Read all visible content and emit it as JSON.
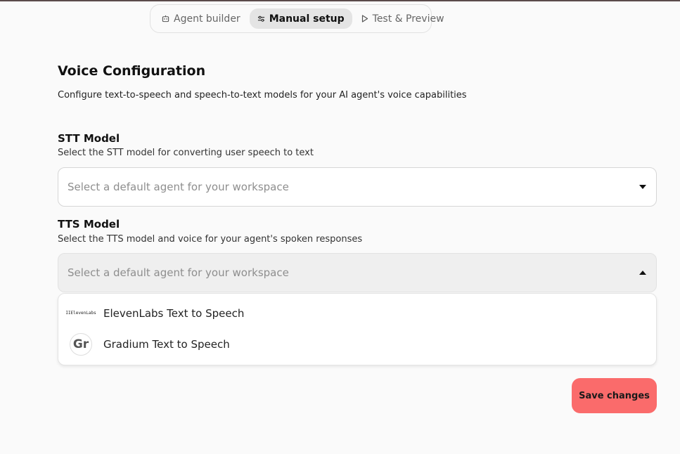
{
  "tabs": [
    {
      "label": "Agent builder",
      "icon": "robot-icon",
      "active": false
    },
    {
      "label": "Manual setup",
      "icon": "sliders-icon",
      "active": true
    },
    {
      "label": "Test & Preview",
      "icon": "play-icon",
      "active": false
    }
  ],
  "section": {
    "title": "Voice Configuration",
    "description": "Configure text-to-speech and speech-to-text models for your AI agent's voice capabilities"
  },
  "stt": {
    "label": "STT Model",
    "help": "Select the STT model for converting user speech to text",
    "placeholder": "Select a default agent for your workspace"
  },
  "tts": {
    "label": "TTS Model",
    "help": "Select the TTS model and voice for your agent's spoken responses",
    "placeholder": "Select a default agent for your workspace",
    "options": [
      {
        "label": "ElevenLabs Text to Speech",
        "logo": "IIElevenLabs"
      },
      {
        "label": "Gradium Text to Speech",
        "logo": "Gr"
      }
    ]
  },
  "actions": {
    "save_label": "Save changes"
  },
  "colors": {
    "accent": "#fa6b6b",
    "active_tab_bg": "#e4e4e4",
    "background": "#fafafa"
  }
}
